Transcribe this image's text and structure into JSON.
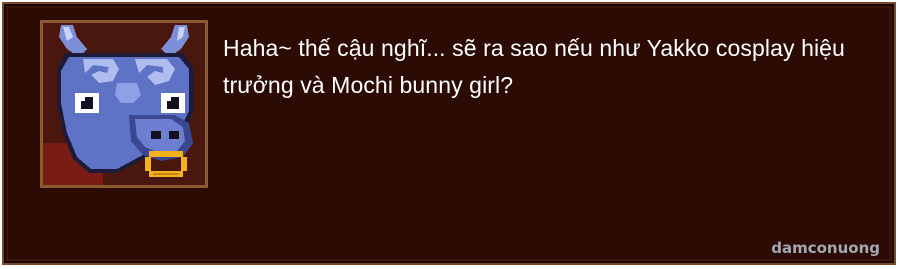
{
  "dialog": {
    "text": "Haha~ thế cậu nghĩ... sẽ ra sao nếu như Yakko cosplay hiệu trưởng và Mochi bunny girl?",
    "portrait_icon": "bull-character-portrait-icon"
  },
  "watermark": {
    "text": "damconuong"
  },
  "colors": {
    "box_background": "#2b0b04",
    "box_border": "#7a4a2a",
    "portrait_frame": "#8a5a32",
    "text": "#ffffff",
    "bull_skin": "#5f73c6",
    "bull_highlight": "#aebcf0",
    "nose_ring": "#f2b21d"
  }
}
